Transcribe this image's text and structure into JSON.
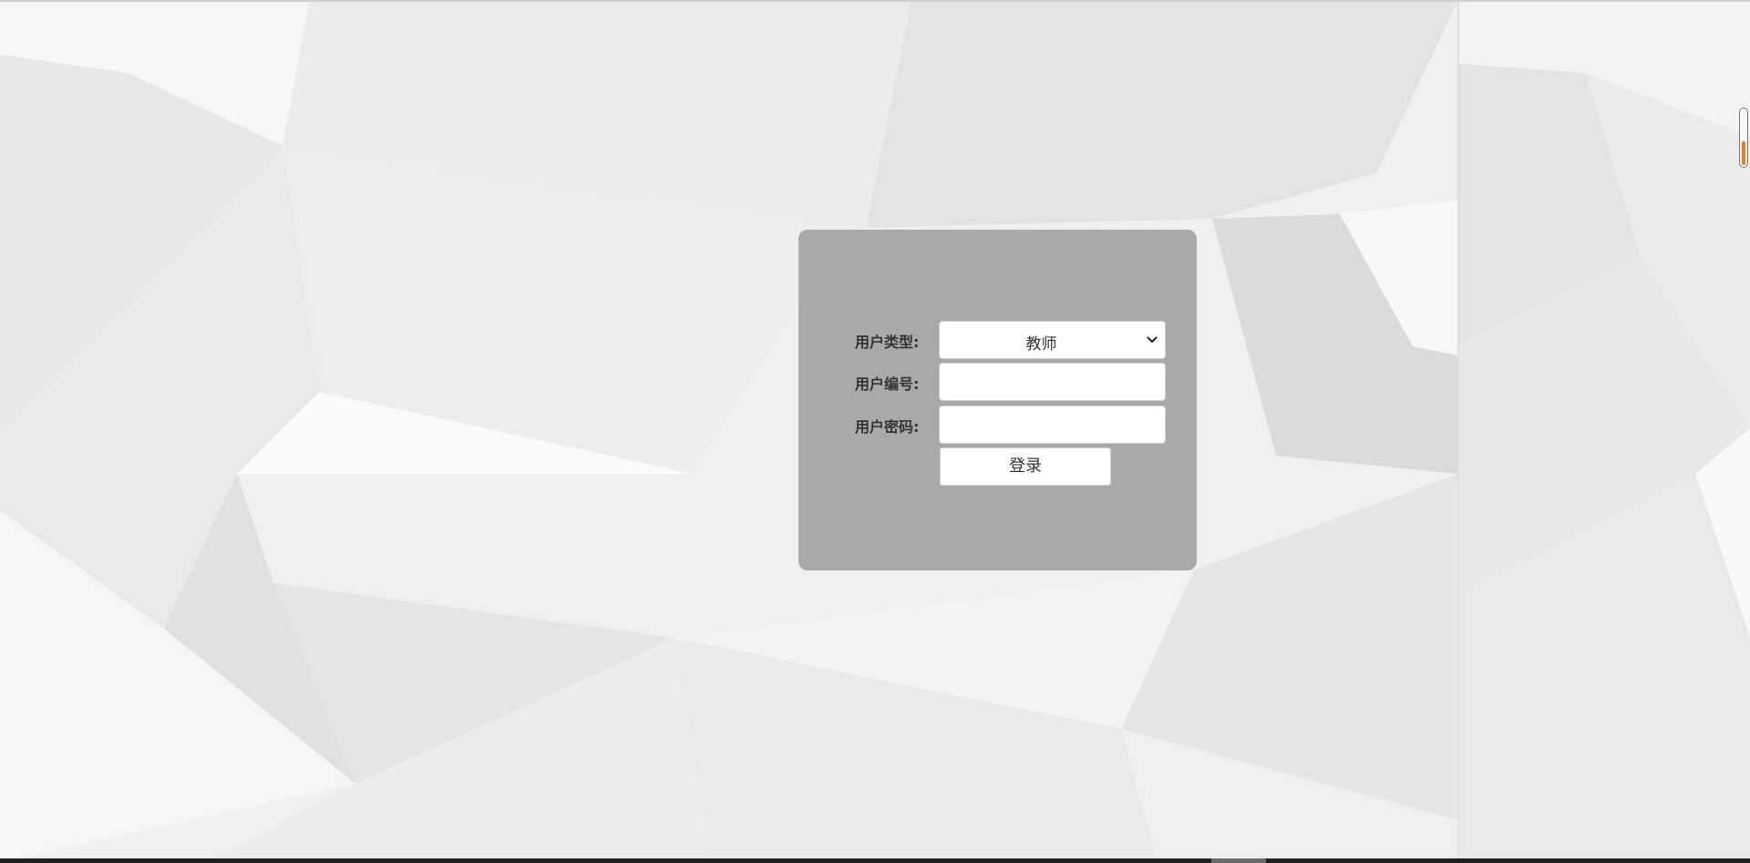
{
  "login_form": {
    "user_type": {
      "label": "用户类型:",
      "selected": "教师"
    },
    "user_id": {
      "label": "用户编号:",
      "value": ""
    },
    "user_password": {
      "label": "用户密码:",
      "value": ""
    },
    "submit_label": "登录"
  },
  "colors": {
    "card_background": "#a9a9a9",
    "page_background": "#f2f2f3",
    "side_widget_fill": "#ee7c1e"
  }
}
